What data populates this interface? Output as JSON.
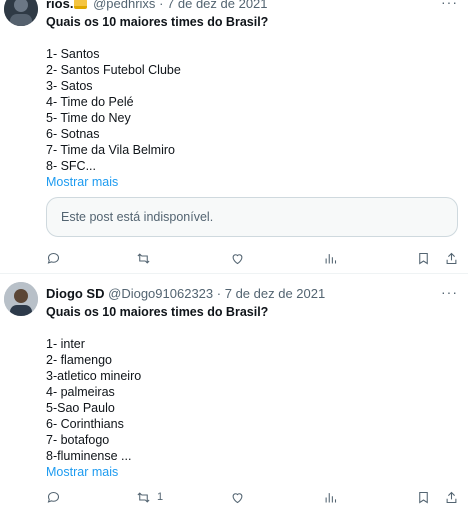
{
  "tweets": [
    {
      "name": "rios.",
      "handle": "@pedhrixs",
      "dot": "·",
      "date": "7 de dez de 2021",
      "title": "Quais os 10 maiores times do Brasil?",
      "lines": [
        "1- Santos",
        "2- Santos Futebol Clube",
        "3- Satos",
        "4- Time do Pelé",
        "5- Time do Ney",
        "6- Sotnas",
        "7- Time da Vila Belmiro",
        "8- SFC..."
      ],
      "show_more": "Mostrar mais",
      "quote": "Este post está indisponível.",
      "actions": {
        "reply_count": "",
        "retweet_count": "",
        "like_count": "",
        "views_count": ""
      }
    },
    {
      "name": "Diogo SD",
      "handle": "@Diogo91062323",
      "dot": "·",
      "date": "7 de dez de 2021",
      "title": "Quais os 10 maiores times do Brasil?",
      "lines": [
        "1- inter",
        "2- flamengo",
        "3-atletico mineiro",
        "4- palmeiras",
        "5-Sao Paulo",
        "6- Corinthians",
        "7- botafogo",
        "8-fluminense ..."
      ],
      "show_more": "Mostrar mais",
      "actions": {
        "reply_count": "",
        "retweet_count": "1",
        "like_count": "",
        "views_count": ""
      }
    }
  ],
  "more_label": "···",
  "colors": {
    "accent": "#1d9bf0",
    "muted": "#536471",
    "text": "#0f1419",
    "border": "#cfd9de"
  }
}
